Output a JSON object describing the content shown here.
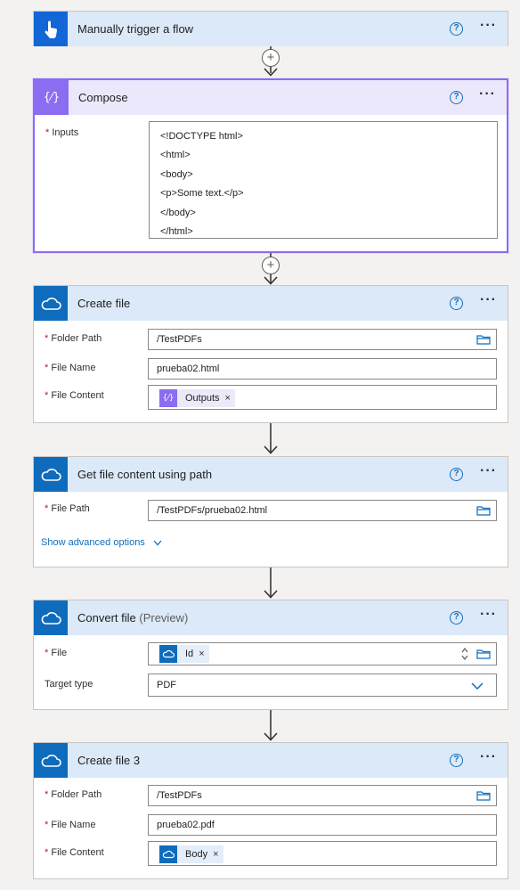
{
  "cards": {
    "trigger": {
      "title": "Manually trigger a flow"
    },
    "compose": {
      "title": "Compose",
      "inputs_label": "Inputs",
      "inputs_lines": [
        "<!DOCTYPE html>",
        "<html>",
        "<body>",
        "<p>Some text.</p>",
        "</body>",
        "</html>"
      ]
    },
    "create_file": {
      "title": "Create file",
      "folder_label": "Folder Path",
      "folder_value": "/TestPDFs",
      "name_label": "File Name",
      "name_value": "prueba02.html",
      "content_label": "File Content",
      "content_token": "Outputs"
    },
    "get_content": {
      "title": "Get file content using path",
      "path_label": "File Path",
      "path_value": "/TestPDFs/prueba02.html",
      "advanced": "Show advanced options"
    },
    "convert": {
      "title": "Convert file",
      "title_suffix": "(Preview)",
      "file_label": "File",
      "file_token": "Id",
      "type_label": "Target type",
      "type_value": "PDF"
    },
    "create_file3": {
      "title": "Create file 3",
      "folder_label": "Folder Path",
      "folder_value": "/TestPDFs",
      "name_label": "File Name",
      "name_value": "prueba02.pdf",
      "content_label": "File Content",
      "content_token": "Body"
    }
  },
  "common": {
    "required": "*",
    "help": "?",
    "more": "···",
    "remove": "×",
    "plus": "+"
  },
  "icons": {
    "trigger": "touch-hand-icon",
    "compose": "compose-braces-icon",
    "onedrive": "onedrive-cloud-icon",
    "folder": "folder-icon",
    "chevron": "chevron-down-icon"
  },
  "colors": {
    "trigger": "#1266d6",
    "onedrive": "#0f6cbd",
    "compose": "#8c6cf0",
    "required": "#a4262c"
  }
}
